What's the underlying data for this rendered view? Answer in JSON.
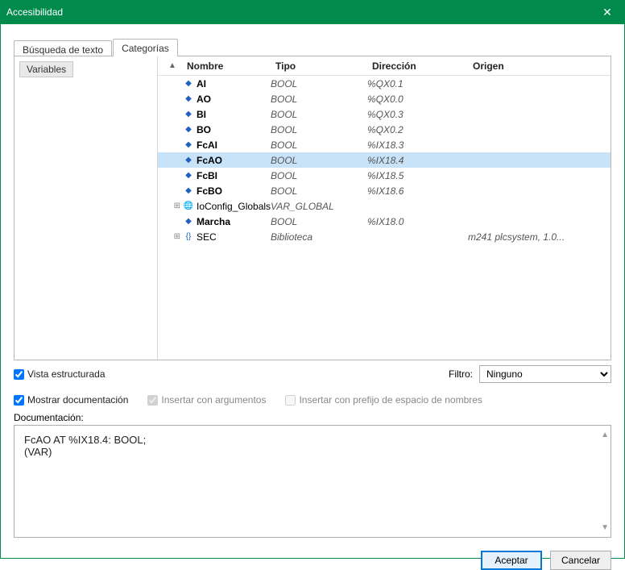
{
  "titlebar": {
    "title": "Accesibilidad",
    "close": "✕"
  },
  "tabs": {
    "search": "Búsqueda de texto",
    "categories": "Categorías"
  },
  "leftTree": {
    "root": "Variables"
  },
  "columns": {
    "name": "Nombre",
    "type": "Tipo",
    "direction": "Dirección",
    "origin": "Origen"
  },
  "rows": [
    {
      "tree": "",
      "icon": "◆",
      "name": "AI",
      "bold": true,
      "type": "BOOL",
      "dir": "%QX0.1",
      "orig": "",
      "selected": false
    },
    {
      "tree": "",
      "icon": "◆",
      "name": "AO",
      "bold": true,
      "type": "BOOL",
      "dir": "%QX0.0",
      "orig": "",
      "selected": false
    },
    {
      "tree": "",
      "icon": "◆",
      "name": "BI",
      "bold": true,
      "type": "BOOL",
      "dir": "%QX0.3",
      "orig": "",
      "selected": false
    },
    {
      "tree": "",
      "icon": "◆",
      "name": "BO",
      "bold": true,
      "type": "BOOL",
      "dir": "%QX0.2",
      "orig": "",
      "selected": false
    },
    {
      "tree": "",
      "icon": "◆",
      "name": "FcAI",
      "bold": true,
      "type": "BOOL",
      "dir": "%IX18.3",
      "orig": "",
      "selected": false
    },
    {
      "tree": "",
      "icon": "◆",
      "name": "FcAO",
      "bold": true,
      "type": "BOOL",
      "dir": "%IX18.4",
      "orig": "",
      "selected": true
    },
    {
      "tree": "",
      "icon": "◆",
      "name": "FcBI",
      "bold": true,
      "type": "BOOL",
      "dir": "%IX18.5",
      "orig": "",
      "selected": false
    },
    {
      "tree": "",
      "icon": "◆",
      "name": "FcBO",
      "bold": true,
      "type": "BOOL",
      "dir": "%IX18.6",
      "orig": "",
      "selected": false
    },
    {
      "tree": "⊞",
      "icon": "🌐",
      "name": "IoConfig_Globals",
      "bold": false,
      "type": "VAR_GLOBAL",
      "dir": "",
      "orig": "",
      "selected": false
    },
    {
      "tree": "",
      "icon": "◆",
      "name": "Marcha",
      "bold": true,
      "type": "BOOL",
      "dir": "%IX18.0",
      "orig": "",
      "selected": false
    },
    {
      "tree": "⊞",
      "icon": "{}",
      "name": "SEC",
      "bold": false,
      "type": "Biblioteca",
      "dir": "",
      "orig": "m241 plcsystem, 1.0...",
      "selected": false
    }
  ],
  "options": {
    "structured": "Vista estructurada",
    "filterLabel": "Filtro:",
    "filterValue": "Ninguno",
    "showDoc": "Mostrar documentación",
    "insertArgs": "Insertar con argumentos",
    "insertPrefix": "Insertar con prefijo de espacio de nombres"
  },
  "doc": {
    "label": "Documentación:",
    "text": "FcAO AT %IX18.4: BOOL;\n(VAR)"
  },
  "buttons": {
    "ok": "Aceptar",
    "cancel": "Cancelar"
  }
}
